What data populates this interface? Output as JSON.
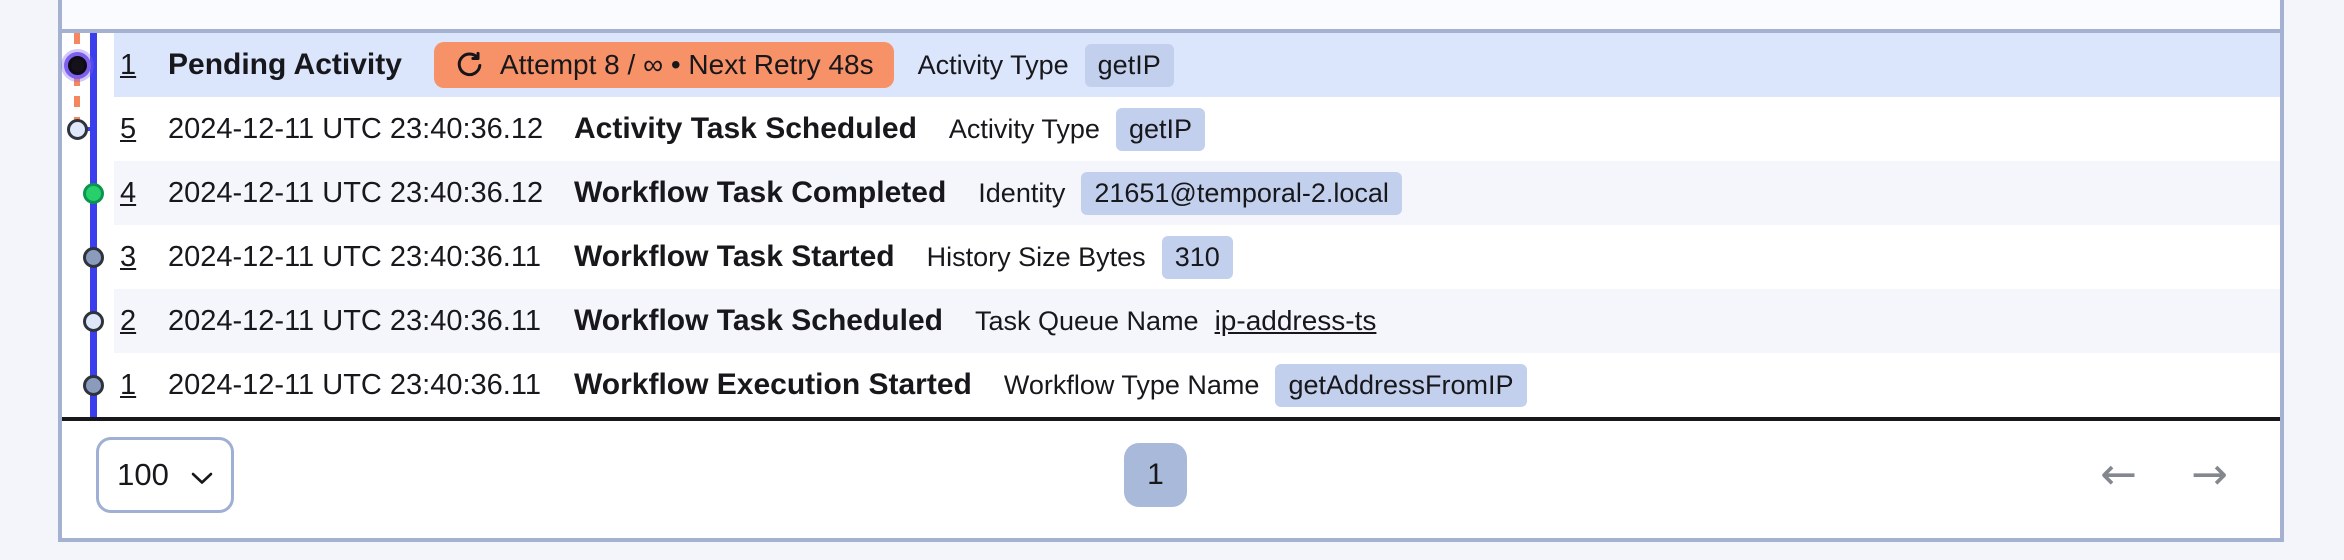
{
  "view": "workflow-event-history",
  "colors": {
    "timeline_blue": "#3a3eec",
    "retry_badge_orange": "#f79168",
    "selected_row_blue": "#dbe5fb",
    "attr_badge_blue": "#c2d0ed",
    "completed_dot_green": "#27d06a",
    "started_dot_gray": "#8b9bbc",
    "scheduled_dot_light": "#dfe8fa",
    "card_border": "#a4b1d0"
  },
  "pending": {
    "number": "1",
    "name": "Pending Activity",
    "retry_text": "Attempt 8 / ∞ • Next Retry 48s",
    "attr_label": "Activity Type",
    "attr_value": "getIP"
  },
  "events": [
    {
      "number": "5",
      "timestamp": "2024-12-11 UTC 23:40:36.12",
      "name": "Activity Task Scheduled",
      "attr_label": "Activity Type",
      "attr_value": "getIP"
    },
    {
      "number": "4",
      "timestamp": "2024-12-11 UTC 23:40:36.12",
      "name": "Workflow Task Completed",
      "attr_label": "Identity",
      "attr_value": "21651@temporal-2.local"
    },
    {
      "number": "3",
      "timestamp": "2024-12-11 UTC 23:40:36.11",
      "name": "Workflow Task Started",
      "attr_label": "History Size Bytes",
      "attr_value": "310"
    },
    {
      "number": "2",
      "timestamp": "2024-12-11 UTC 23:40:36.11",
      "name": "Workflow Task Scheduled",
      "attr_label": "Task Queue Name",
      "attr_value": "ip-address-ts"
    },
    {
      "number": "1",
      "timestamp": "2024-12-11 UTC 23:40:36.11",
      "name": "Workflow Execution Started",
      "attr_label": "Workflow Type Name",
      "attr_value": "getAddressFromIP"
    }
  ],
  "pagination": {
    "page_size": "100",
    "current_page": "1",
    "prev_arrow": "←",
    "next_arrow": "→"
  }
}
